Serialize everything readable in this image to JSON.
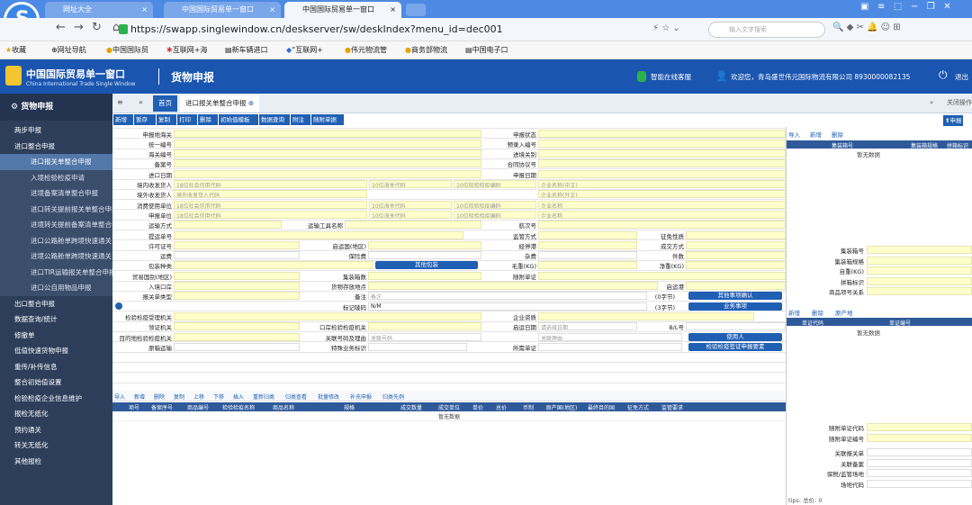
{
  "browser": {
    "tabs": [
      {
        "label": "网址大全"
      },
      {
        "label": "中国国际贸易单一窗口"
      },
      {
        "label": "中国国际贸易单一窗口"
      }
    ],
    "url": "https://swapp.singlewindow.cn/deskserver/sw/deskIndex?menu_id=dec001",
    "search_placeholder": "输入文字搜索",
    "bookmarks": [
      "收藏",
      "网址导航",
      "中国国际贸",
      "互联网+海",
      "新车辆进口",
      "“互联网+",
      "伟元物流管",
      "商务部物流",
      "中国电子口"
    ]
  },
  "header": {
    "logo_cn": "中国国际贸易单一窗口",
    "logo_en": "China International Trade Single Window",
    "module": "货物申报",
    "service": "智能在线客服",
    "welcome": "欢迎您，青岛盛世伟元国际物流有限公司 8930000082135",
    "logout": "退出"
  },
  "sidebar": {
    "title": "货物申报",
    "items": [
      {
        "label": "两步申报",
        "type": "item"
      },
      {
        "label": "进口整合申报",
        "type": "item"
      },
      {
        "label": "进口报关单整合申报",
        "type": "sub",
        "selected": true
      },
      {
        "label": "入境检验检疫申请",
        "type": "sub"
      },
      {
        "label": "进境备案清单整合申报",
        "type": "sub"
      },
      {
        "label": "进口转关提前报关单整合申报",
        "type": "sub"
      },
      {
        "label": "进境转关提前备案清单整合申报",
        "type": "sub"
      },
      {
        "label": "进口公路舱单跨境快速通关",
        "type": "sub"
      },
      {
        "label": "进境公路舱单跨境快速通关",
        "type": "sub"
      },
      {
        "label": "进口TIR运输报关单整合申报",
        "type": "sub"
      },
      {
        "label": "进口公自用物品申报",
        "type": "sub"
      },
      {
        "label": "出口整合申报",
        "type": "item"
      },
      {
        "label": "数据查询/统计",
        "type": "item"
      },
      {
        "label": "修撤单",
        "type": "item"
      },
      {
        "label": "低值快速货物申报",
        "type": "item"
      },
      {
        "label": "重传/补传信息",
        "type": "item"
      },
      {
        "label": "整合初始值设置",
        "type": "item"
      },
      {
        "label": "检验检疫企业信息维护",
        "type": "item"
      },
      {
        "label": "报检无纸化",
        "type": "item"
      },
      {
        "label": "预约通关",
        "type": "item"
      },
      {
        "label": "转关无纸化",
        "type": "item"
      },
      {
        "label": "其他报检",
        "type": "item"
      }
    ]
  },
  "main_tabs": {
    "home": "首页",
    "active": "进口报关单整合申报",
    "close_ops": "关闭操作"
  },
  "toolbar": [
    "新增",
    "暂存",
    "复制",
    "打印",
    "删除",
    "初始值模板",
    "数据查询",
    "附注",
    "随附单据"
  ],
  "declare_button": "申报",
  "form": {
    "r1": {
      "a": "申报地海关",
      "b": "申报状态"
    },
    "r2": {
      "a": "统一编号",
      "b": "预录入编号"
    },
    "r3": {
      "a": "海关编号",
      "b": "进境关别"
    },
    "r4": {
      "a": "备案号",
      "b": "合同协议号"
    },
    "r5": {
      "a": "进口日期",
      "b": "申报日期"
    },
    "r6": {
      "a": "境内收发货人",
      "p1": "18位社会信用代码",
      "p2": "10位海关代码",
      "p3": "10位检验检疫编码",
      "p4": "企业名称(中文)"
    },
    "r7": {
      "a": "境外收发货人",
      "p1": "境外收发货人代码",
      "p4": "企业名称(外文)"
    },
    "r8": {
      "a": "消费使用单位",
      "p1": "18位社会信用代码",
      "p2": "10位海关代码",
      "p3": "10位检验检疫编码",
      "p4": "企业名称"
    },
    "r9": {
      "a": "申报单位",
      "p1": "18位社会信用代码",
      "p2": "10位海关代码",
      "p3": "10位检验检疫编码",
      "p4": "企业名称"
    },
    "r10": {
      "a": "运输方式",
      "b": "运输工具名称",
      "c": "航次号"
    },
    "r11": {
      "a": "提运单号",
      "b": "监管方式",
      "c": "征免性质"
    },
    "r12": {
      "a": "许可证号",
      "b": "启运国(地区)",
      "c": "经停港",
      "d": "成交方式"
    },
    "r13": {
      "a": "运费",
      "b": "保险费",
      "c": "杂费",
      "d": "件数"
    },
    "r14": {
      "a": "包装种类",
      "btn": "其他包装",
      "c": "毛重(KG)",
      "d": "净重(KG)"
    },
    "r15": {
      "a": "贸易国别(地区)",
      "b": "集装箱数",
      "c": "随附单证"
    },
    "r16": {
      "a": "入境口岸",
      "b": "货物存放地点",
      "c": "启运港"
    },
    "r17": {
      "a": "报关单类型",
      "b": "备注",
      "note_ph": "备注",
      "bytes": "(0字节)",
      "btn": "其他事项确认"
    },
    "r18": {
      "b": "标记唛码",
      "mark": "N/M",
      "bytes": "(3字节)",
      "btn": "业务事项"
    },
    "r19": {
      "a": "检验检疫受理机关",
      "c": "企业资质"
    },
    "r20": {
      "a": "领证机关",
      "b": "口岸检验检疫机关",
      "c": "启运日期",
      "date_ph": "请选择日期",
      "d": "B/L号"
    },
    "r21": {
      "a": "目的地检验检疫机关",
      "b": "关联号码及理由",
      "ph1": "关联号码",
      "ph2": "关联理由",
      "btn": "使用人"
    },
    "r22": {
      "a": "原箱运输",
      "b": "特殊业务标识",
      "c": "所需单证",
      "btn": "检验检疫签证申报要素"
    }
  },
  "goods_toolbar": [
    "导入",
    "新增",
    "删除",
    "复制",
    "上移",
    "下移",
    "插入",
    "重新归类",
    "归类查看",
    "批量修改",
    "补充申报",
    "归类先例"
  ],
  "goods_headers": [
    "项号",
    "备案序号",
    "商品编号",
    "检验检疫名称",
    "商品名称",
    "规格",
    "成交数量",
    "成交单位",
    "单价",
    "总价",
    "币制",
    "原产国(地区)",
    "最终目的国",
    "征免方式",
    "监管要求"
  ],
  "no_data": "暂无数据",
  "right_panel": {
    "toolbar1": [
      "导入",
      "新增",
      "删除"
    ],
    "container_headers": [
      "集装箱号",
      "集装箱规格",
      "拼箱标识"
    ],
    "container_fields": [
      "集装箱号",
      "集装箱规格",
      "自重(KG)",
      "拼箱标识",
      "商品项号关系"
    ],
    "toolbar2": [
      "新增",
      "删除",
      "原产地"
    ],
    "doc_headers": [
      "单证代码",
      "单证编号"
    ],
    "doc_fields": [
      "随附单证代码",
      "随附单证编号"
    ],
    "assoc_fields": [
      "关联报关单",
      "关联备案",
      "保税/监管场地",
      "场地代码"
    ],
    "tips": "tips: 总价: 0"
  }
}
